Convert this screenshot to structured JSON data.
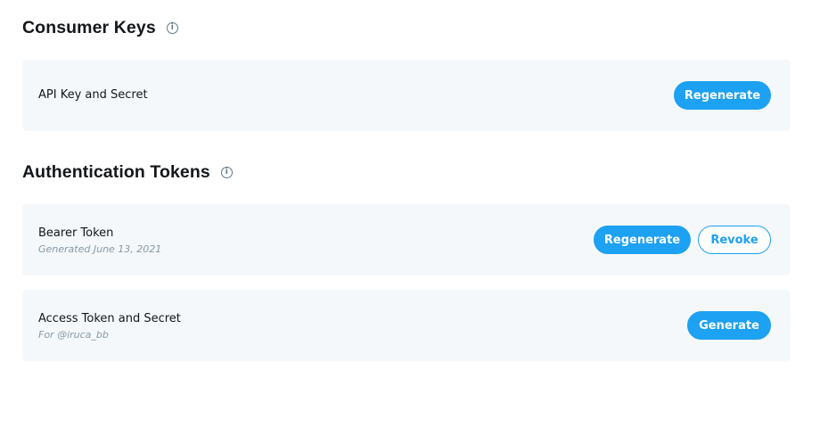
{
  "consumer_keys": {
    "title": "Consumer Keys",
    "info_icon": "info-icon",
    "api_key": {
      "label": "API Key and Secret",
      "regenerate_label": "Regenerate"
    }
  },
  "auth_tokens": {
    "title": "Authentication Tokens",
    "info_icon": "info-icon",
    "bearer": {
      "label": "Bearer Token",
      "sub": "Generated June 13, 2021",
      "regenerate_label": "Regenerate",
      "revoke_label": "Revoke"
    },
    "access": {
      "label": "Access Token and Secret",
      "sub": "For @iruca_bb",
      "generate_label": "Generate"
    }
  },
  "colors": {
    "accent": "#1da1f2",
    "card_bg": "#f5f8fa",
    "muted": "#8899a6"
  }
}
